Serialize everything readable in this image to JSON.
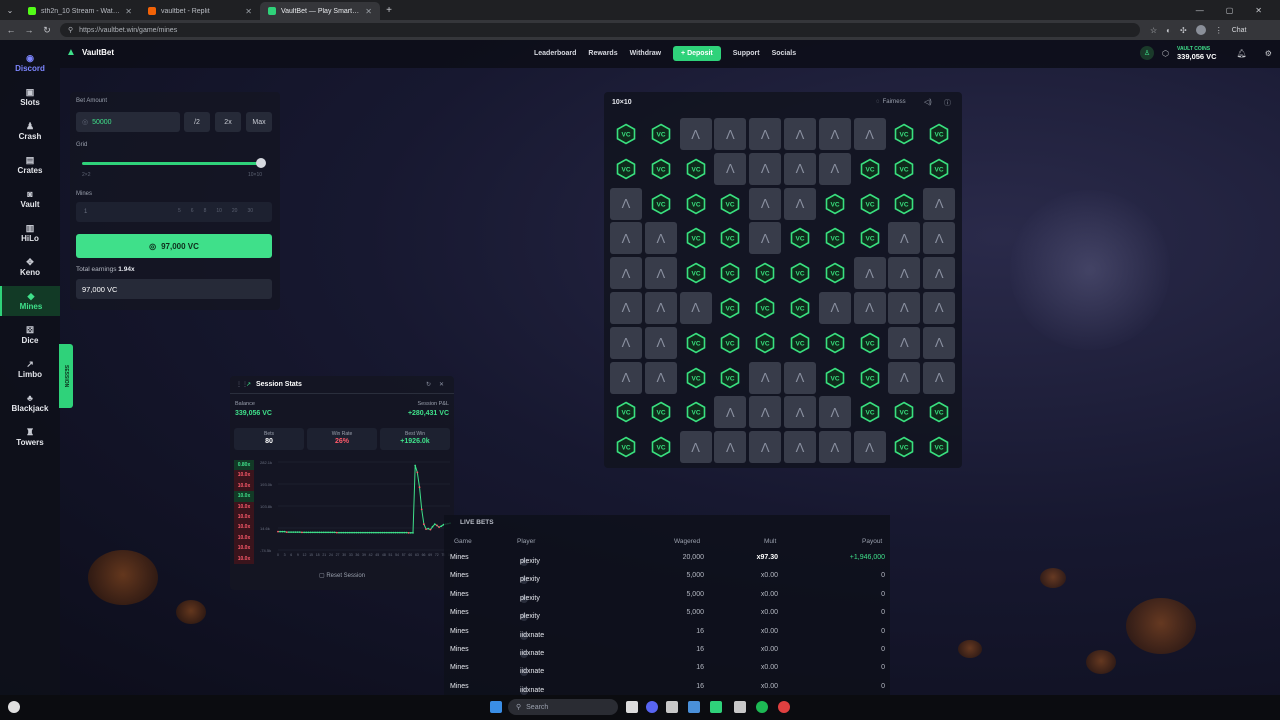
{
  "browser": {
    "tabs": [
      {
        "title": "sth2n_10 Stream - Watch Live on",
        "color": "#53fc18",
        "active": false
      },
      {
        "title": "vaultbet - Replit",
        "color": "#f26207",
        "active": false
      },
      {
        "title": "VaultBet — Play Smarter, Bet",
        "color": "#2fd27a",
        "active": true
      }
    ],
    "url": "https://vaultbet.win/game/mines",
    "chat_label": "Chat"
  },
  "brand": {
    "name": "VaultBet"
  },
  "nav": {
    "items": [
      "Leaderboard",
      "Rewards",
      "Withdraw"
    ],
    "deposit": "Deposit",
    "items_after": [
      "Support",
      "Socials"
    ]
  },
  "wallet": {
    "label": "VAULT COINS",
    "value": "339,056 VC"
  },
  "sidebar": {
    "items": [
      {
        "label": "Discord",
        "icon": "discord-icon",
        "glyph": "◉"
      },
      {
        "label": "Slots",
        "icon": "slots-icon",
        "glyph": "▣"
      },
      {
        "label": "Crash",
        "icon": "crash-icon",
        "glyph": "♟"
      },
      {
        "label": "Crates",
        "icon": "crates-icon",
        "glyph": "▤"
      },
      {
        "label": "Vault",
        "icon": "vault-icon",
        "glyph": "◙"
      },
      {
        "label": "HiLo",
        "icon": "hilo-icon",
        "glyph": "▥"
      },
      {
        "label": "Keno",
        "icon": "keno-icon",
        "glyph": "✥"
      },
      {
        "label": "Mines",
        "icon": "mines-icon",
        "glyph": "◆"
      },
      {
        "label": "Dice",
        "icon": "dice-icon",
        "glyph": "⚄"
      },
      {
        "label": "Limbo",
        "icon": "limbo-icon",
        "glyph": "↗"
      },
      {
        "label": "Blackjack",
        "icon": "blackjack-icon",
        "glyph": "♣"
      },
      {
        "label": "Towers",
        "icon": "towers-icon",
        "glyph": "♜"
      }
    ],
    "active": "Mines",
    "session_tab": "SESSION"
  },
  "bet": {
    "amount_label": "Bet Amount",
    "amount_value": "50000",
    "half": "/2",
    "double": "2x",
    "max": "Max",
    "grid_label": "Grid",
    "grid_min": "2×2",
    "grid_max": "10×10",
    "mines_label": "Mines",
    "mines_value": "1",
    "mines_presets": [
      "5",
      "6",
      "8",
      "10",
      "20",
      "30"
    ],
    "cashout_label": "97,000 VC",
    "earnings_label": "Total earnings",
    "earnings_mult": "1.94x",
    "earnings_value": "97,000 VC"
  },
  "board": {
    "title": "10×10",
    "fairness": "Fairness",
    "gem_label": "VC",
    "rows": [
      "GGHHHHHHGG",
      "GGGHHHHGGG",
      "HGGGHHGGGH",
      "HHGGHGGGHH",
      "HHGGGGGHHH",
      "HHHGGGHHHH",
      "HHGGGGGGHH",
      "HHGGHHGGHH",
      "GGGHHHHGGG",
      "GGHHHHHHGG"
    ]
  },
  "session": {
    "title": "Session Stats",
    "balance_label": "Balance",
    "balance_value": "339,056 VC",
    "pnl_label": "Session P&L",
    "pnl_value": "+280,431 VC",
    "bets_label": "Bets",
    "bets_value": "80",
    "winrate_label": "Win Rate",
    "winrate_value": "26%",
    "bestwin_label": "Best Win",
    "bestwin_value": "+1926.0k",
    "multipliers": [
      {
        "v": "0.80x",
        "win": true
      },
      {
        "v": "10.0x",
        "win": false
      },
      {
        "v": "10.0x",
        "win": false
      },
      {
        "v": "10.0x",
        "win": true
      },
      {
        "v": "10.0x",
        "win": false
      },
      {
        "v": "10.0x",
        "win": false
      },
      {
        "v": "10.0x",
        "win": false
      },
      {
        "v": "10.0x",
        "win": false
      },
      {
        "v": "10.0x",
        "win": false
      },
      {
        "v": "10.0x",
        "win": false
      }
    ],
    "reset": "Reset Session"
  },
  "chart_data": {
    "type": "line",
    "title": "",
    "xlabel": "",
    "ylabel": "",
    "y_ticks": [
      "282.1k",
      "193.0k",
      "103.8k",
      "14.6k",
      "-74.5k"
    ],
    "x_ticks": [
      "0",
      "3",
      "6",
      "9",
      "12",
      "15",
      "18",
      "21",
      "24",
      "27",
      "30",
      "33",
      "36",
      "39",
      "42",
      "45",
      "48",
      "51",
      "54",
      "57",
      "60",
      "63",
      "66",
      "69",
      "72",
      "75",
      "80"
    ],
    "ylim": [
      -74.5,
      282.1
    ],
    "series": [
      {
        "values": [
          0,
          0,
          0,
          0,
          -2,
          -2,
          -2,
          -2,
          -2,
          -2,
          -2,
          -3,
          -3,
          -3,
          -3,
          -3,
          -3,
          -3,
          -3,
          -3,
          -3,
          -3,
          -3,
          -3,
          -3,
          -3,
          -3,
          -4,
          -4,
          -4,
          -4,
          -4,
          -4,
          -4,
          -4,
          -4,
          -4,
          -4,
          -4,
          -4,
          -4,
          -4,
          -4,
          -4,
          -4,
          -4,
          -4,
          -4,
          -4,
          -4,
          -4,
          -4,
          -4,
          -4,
          -4,
          -4,
          -4,
          -4,
          -4,
          -4,
          -5,
          -5,
          -5,
          268,
          240,
          180,
          90,
          30,
          10,
          12,
          8,
          20,
          30,
          25,
          18,
          22,
          28,
          30,
          32,
          34
        ]
      }
    ]
  },
  "livebets": {
    "title": "LIVE BETS",
    "headers": {
      "game": "Game",
      "player": "Player",
      "wagered": "Wagered",
      "mult": "Mult",
      "payout": "Payout"
    },
    "rows": [
      {
        "game": "Mines",
        "badge": "P",
        "player": "plexity",
        "wagered": "20,000",
        "mult": "x97.30",
        "payout": "+1,946,000",
        "win": true
      },
      {
        "game": "Mines",
        "badge": "P",
        "player": "plexity",
        "wagered": "5,000",
        "mult": "x0.00",
        "payout": "0",
        "win": false
      },
      {
        "game": "Mines",
        "badge": "P",
        "player": "plexity",
        "wagered": "5,000",
        "mult": "x0.00",
        "payout": "0",
        "win": false
      },
      {
        "game": "Mines",
        "badge": "P",
        "player": "plexity",
        "wagered": "5,000",
        "mult": "x0.00",
        "payout": "0",
        "win": false
      },
      {
        "game": "Mines",
        "badge": "I",
        "player": "iidxnate",
        "wagered": "16",
        "mult": "x0.00",
        "payout": "0",
        "win": false
      },
      {
        "game": "Mines",
        "badge": "I",
        "player": "iidxnate",
        "wagered": "16",
        "mult": "x0.00",
        "payout": "0",
        "win": false
      },
      {
        "game": "Mines",
        "badge": "I",
        "player": "iidxnate",
        "wagered": "16",
        "mult": "x0.00",
        "payout": "0",
        "win": false
      },
      {
        "game": "Mines",
        "badge": "I",
        "player": "iidxnate",
        "wagered": "16",
        "mult": "x0.00",
        "payout": "0",
        "win": false
      }
    ]
  },
  "taskbar": {
    "search": "Search"
  }
}
